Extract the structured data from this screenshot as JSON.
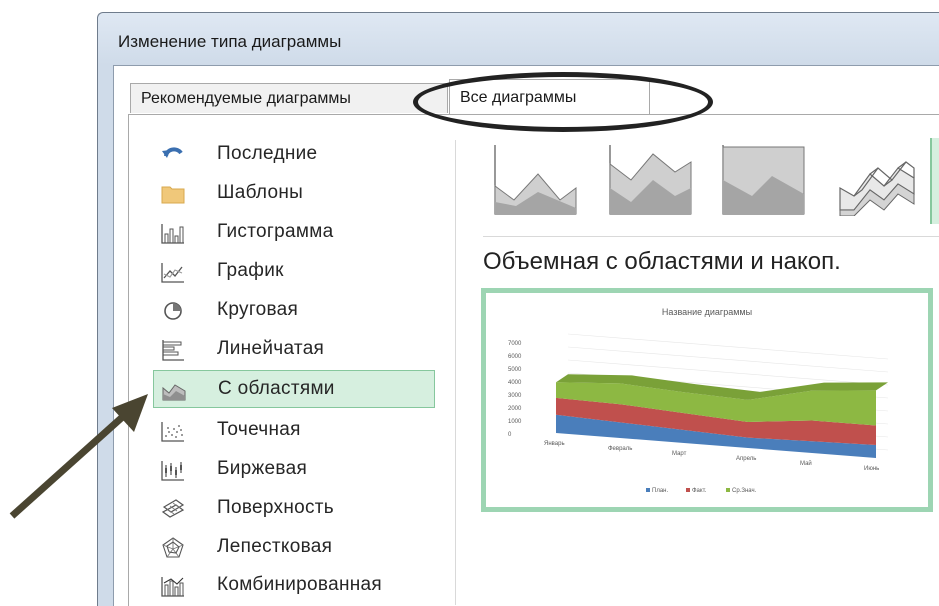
{
  "dialog": {
    "title": "Изменение типа диаграммы",
    "tabs": [
      {
        "label": "Рекомендуемые диаграммы",
        "active": false
      },
      {
        "label": "Все диаграммы",
        "active": true
      }
    ]
  },
  "nav": {
    "items": [
      {
        "label": "Последние",
        "icon": "undo-icon"
      },
      {
        "label": "Шаблоны",
        "icon": "folder-icon"
      },
      {
        "label": "Гистограмма",
        "icon": "column-chart-icon"
      },
      {
        "label": "График",
        "icon": "line-chart-icon"
      },
      {
        "label": "Круговая",
        "icon": "pie-chart-icon"
      },
      {
        "label": "Линейчатая",
        "icon": "bar-chart-icon"
      },
      {
        "label": "С областями",
        "icon": "area-chart-icon",
        "selected": true
      },
      {
        "label": "Точечная",
        "icon": "scatter-chart-icon"
      },
      {
        "label": "Биржевая",
        "icon": "stock-chart-icon"
      },
      {
        "label": "Поверхность",
        "icon": "surface-chart-icon"
      },
      {
        "label": "Лепестковая",
        "icon": "radar-chart-icon"
      },
      {
        "label": "Комбинированная",
        "icon": "combo-chart-icon"
      }
    ]
  },
  "subtypes": [
    "area",
    "stacked-area",
    "100-percent-stacked-area",
    "3d-area"
  ],
  "preview": {
    "heading": "Объемная с областями и накоп.",
    "chart_title": "Название диаграммы"
  },
  "colors": {
    "selection_fill": "#d6efdf",
    "selection_border": "#86c79d",
    "series_blue": "#4a7ebb",
    "series_red": "#c0504d",
    "series_green": "#8db843"
  },
  "chart_data": {
    "type": "area",
    "title": "Название диаграммы",
    "categories": [
      "Январь",
      "Февраль",
      "Март",
      "Апрель",
      "Май",
      "Июнь"
    ],
    "series": [
      {
        "name": "План.",
        "values": [
          1400,
          1200,
          1000,
          800,
          900,
          1000
        ]
      },
      {
        "name": "Факт.",
        "values": [
          1300,
          1400,
          1300,
          1200,
          1600,
          1500
        ]
      },
      {
        "name": "Ср.Знач.",
        "values": [
          1200,
          1600,
          1600,
          1700,
          2300,
          2700
        ]
      }
    ],
    "yticks": [
      "7000",
      "6000",
      "5000",
      "4000",
      "3000",
      "2000",
      "1000",
      "0"
    ],
    "ylim": [
      0,
      7000
    ],
    "legend": "bottom",
    "stacked": true
  }
}
